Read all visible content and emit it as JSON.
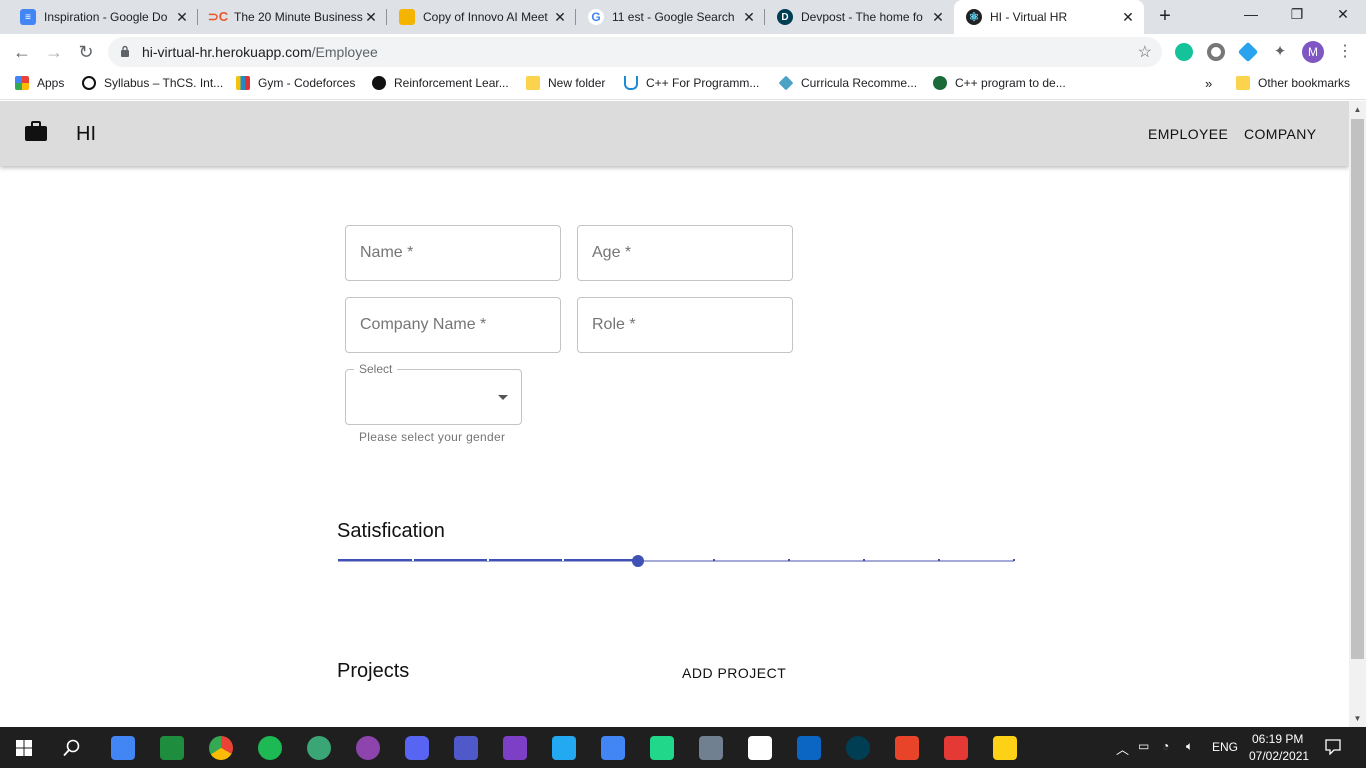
{
  "browser": {
    "tabs": [
      {
        "title": "Inspiration - Google Do",
        "icon": "docs-icon",
        "color": "#4285f4"
      },
      {
        "title": "The 20 Minute Business",
        "icon": "cc-icon",
        "color": "#e8582e"
      },
      {
        "title": "Copy of Innovo AI Meet",
        "icon": "slides-icon",
        "color": "#f4b400"
      },
      {
        "title": "11 est - Google Search",
        "icon": "google-icon",
        "color": "#ffffff"
      },
      {
        "title": "Devpost - The home fo",
        "icon": "devpost-icon",
        "color": "#003e54"
      },
      {
        "title": "HI - Virtual HR",
        "icon": "react-icon",
        "color": "#222222",
        "active": true
      }
    ],
    "url_host": "hi-virtual-hr.herokuapp.com",
    "url_path": "/Employee",
    "profile_initial": "M",
    "bookmarks": [
      {
        "label": "Apps",
        "icon": "apps-grid-icon",
        "color": "#e94235"
      },
      {
        "label": "Syllabus – ThCS. Int...",
        "icon": "syllabus-icon",
        "color": "#111111"
      },
      {
        "label": "Gym - Codeforces",
        "icon": "codeforces-icon",
        "color": "#1f8acb"
      },
      {
        "label": "Reinforcement Lear...",
        "icon": "medium-icon",
        "color": "#111111"
      },
      {
        "label": "New folder",
        "icon": "folder-icon",
        "color": "#fcd34d"
      },
      {
        "label": "C++ For Programm...",
        "icon": "udemy-icon",
        "color": "#1c8ad6"
      },
      {
        "label": "Curricula Recomme...",
        "icon": "diamond-icon",
        "color": "#4aa3c7"
      },
      {
        "label": "C++ program to de...",
        "icon": "gfg-icon",
        "color": "#1b6b3a"
      }
    ],
    "more_bookmarks": "»",
    "other_bookmarks": "Other bookmarks"
  },
  "app": {
    "logo_text": "HI",
    "nav": [
      "EMPLOYEE",
      "COMPANY"
    ],
    "form": {
      "name_placeholder": "Name *",
      "age_placeholder": "Age *",
      "company_placeholder": "Company Name *",
      "role_placeholder": "Role *",
      "select_label": "Select",
      "select_value": "",
      "select_helper": "Please select your gender"
    },
    "satisfaction": {
      "title": "Satisfication",
      "value": 4,
      "min": 0,
      "max": 9,
      "accent": "#3f51b5"
    },
    "projects": {
      "title": "Projects",
      "add_label": "ADD PROJECT"
    }
  },
  "taskbar": {
    "time": "06:19 PM",
    "date": "07/02/2021",
    "language": "ENG",
    "apps": [
      "calendar-icon",
      "classroom-icon",
      "chrome-icon",
      "spotify-icon",
      "atom-icon",
      "github-desktop-icon",
      "discord-icon",
      "teams-icon",
      "visual-studio-icon",
      "vscode-icon",
      "docs-icon",
      "pycharm-icon",
      "unity-icon",
      "writer-icon",
      "bookmark-icon",
      "devpost-icon",
      "gear-app-icon",
      "tasks-icon",
      "sticky-notes-icon"
    ]
  }
}
